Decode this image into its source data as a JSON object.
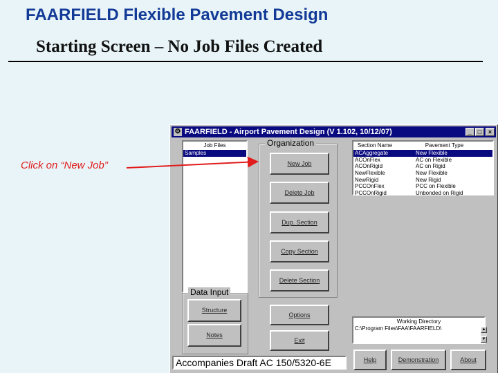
{
  "slide": {
    "title": "FAARFIELD Flexible Pavement Design",
    "subtitle": "Starting Screen – No Job Files Created",
    "callout": "Click on “New Job”"
  },
  "window": {
    "title": "FAARFIELD - Airport Pavement Design (V 1.102, 10/12/07)",
    "app_icon": "⚙",
    "min_glyph": "_",
    "max_glyph": "□",
    "close_glyph": "×"
  },
  "job_files": {
    "header": "Job Files",
    "items": [
      "Samples"
    ]
  },
  "organization": {
    "label": "Organization",
    "new_job": "New Job",
    "delete_job": "Delete Job",
    "dup_section": "Dup. Section",
    "copy_section": "Copy Section",
    "delete_section": "Delete Section"
  },
  "sections": {
    "header_name": "Section Name",
    "header_type": "Pavement Type",
    "rows": [
      {
        "name": "ACAggregate",
        "type": "New Flexible"
      },
      {
        "name": "ACOnFlex",
        "type": "AC on Flexible"
      },
      {
        "name": "ACOnRigid",
        "type": "AC on Rigid"
      },
      {
        "name": "NewFlexible",
        "type": "New Flexible"
      },
      {
        "name": "NewRigid",
        "type": "New Rigid"
      },
      {
        "name": "PCCOnFlex",
        "type": "PCC on Flexible"
      },
      {
        "name": "PCCOnRigid",
        "type": "Unbonded on Rigid"
      }
    ]
  },
  "data_input": {
    "label": "Data Input",
    "structure": "Structure",
    "notes": "Notes"
  },
  "buttons": {
    "options": "Options",
    "exit": "Exit",
    "help": "Help",
    "demonstration": "Demonstration",
    "about": "About"
  },
  "working_directory": {
    "header": "Working Directory",
    "path": "C:\\Program Files\\FAA\\FAARFIELD\\"
  },
  "status_text": "Accompanies Draft AC 150/5320-6E",
  "colors": {
    "title_blue": "#123a96",
    "callout_red": "#e21c1c",
    "titlebar": "#0a0a80",
    "face": "#c0c0c0",
    "background": "#e8f4f8"
  }
}
